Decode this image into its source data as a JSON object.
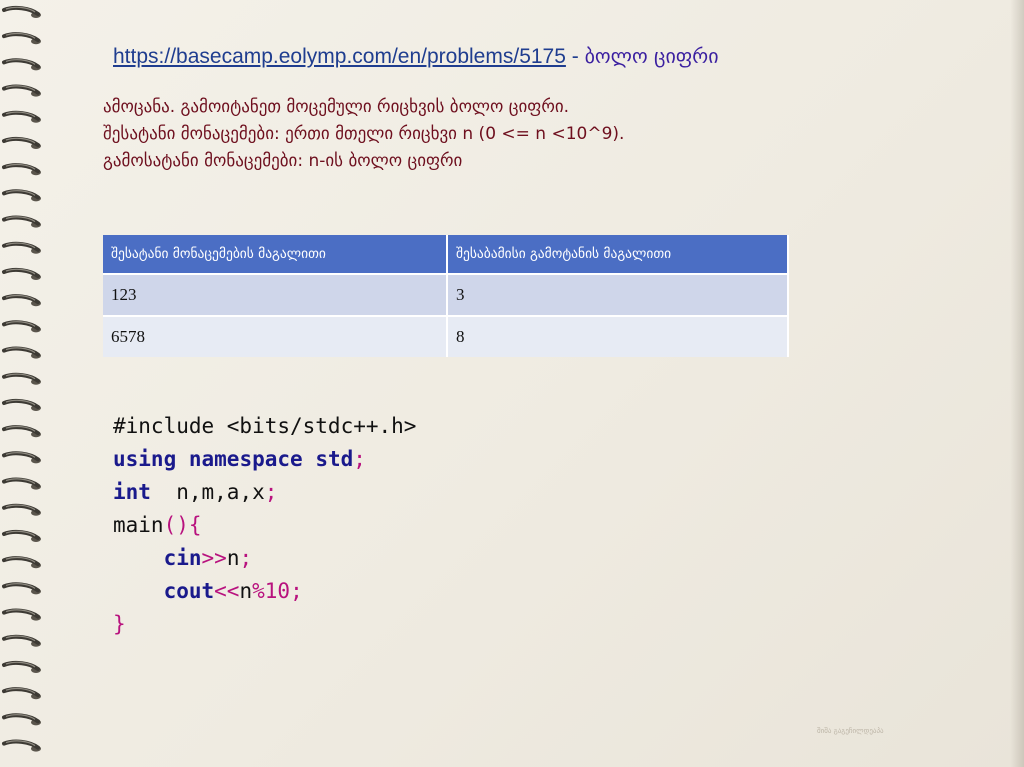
{
  "header": {
    "link_text": "https://basecamp.eolymp.com/en/problems/5175",
    "separator": " - ",
    "title": "ბოლო ციფრი"
  },
  "description": {
    "line1": "ამოცანა. გამოიტანეთ მოცემული რიცხვის ბოლო ციფრი.",
    "line2": "შესატანი მონაცემები: ერთი მთელი რიცხვი n (0 <= n <10^9).",
    "line3": "გამოსატანი მონაცემები: n-ის ბოლო ციფრი"
  },
  "examples_table": {
    "headers": [
      "შესატანი მონაცემების მაგალითი",
      "შესაბამისი გამოტანის მაგალითი"
    ],
    "rows": [
      [
        "123",
        "3"
      ],
      [
        "6578",
        "8"
      ]
    ]
  },
  "code": {
    "include_line": "#include <bits/stdc++.h>",
    "using": "using",
    "namespace": "namespace",
    "std": "std",
    "semicolon": ";",
    "int_kw": "int",
    "decl_vars": "  n,m,a,x",
    "main_sig": "main",
    "main_parens": "()",
    "open_brace": "{",
    "cin_kw": "cin",
    "shift_in": ">>",
    "cin_var": "n",
    "cout_kw": "cout",
    "shift_out": "<<",
    "cout_var": "n",
    "mod_op": "%",
    "mod_num": "10",
    "close_brace": "}"
  },
  "footer": {
    "watermark": "შიშა გაგეჩილდეაპა"
  },
  "colors": {
    "link": "#1f3d8f",
    "description_text": "#6e0f1e",
    "table_header": "#4b6ec4",
    "table_row1": "#cfd6ea",
    "table_row2": "#e7ebf4",
    "code_keyword": "#1a1a8c",
    "code_operator": "#b8127e"
  }
}
